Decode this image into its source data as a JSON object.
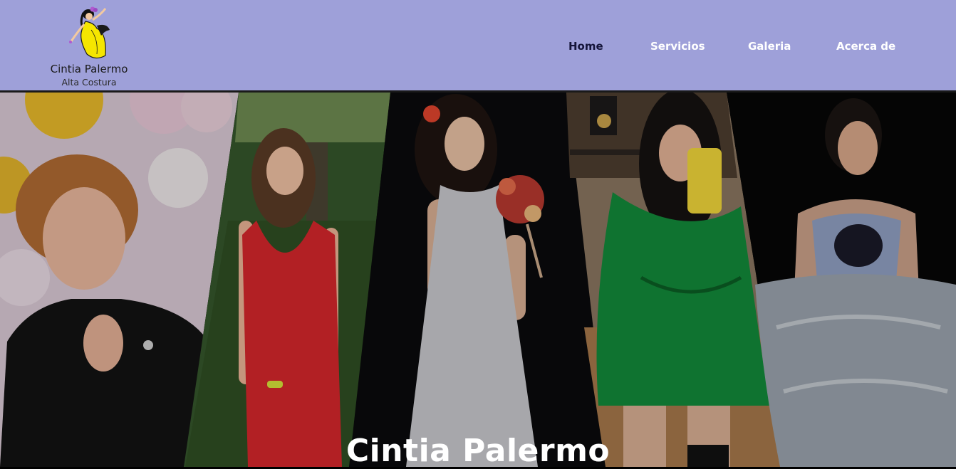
{
  "brand": {
    "name": "Cintia Palermo",
    "subtitle": "Alta Costura",
    "logo_icon": "dancing-woman-yellow-dress-logo"
  },
  "nav": {
    "items": [
      {
        "label": "Home",
        "active": true
      },
      {
        "label": "Servicios",
        "active": false
      },
      {
        "label": "Galeria",
        "active": false
      },
      {
        "label": "Acerca de",
        "active": false
      }
    ]
  },
  "hero": {
    "title": "Cintia Palermo",
    "panels": [
      "photo-woman-black-lace-dress",
      "photo-woman-red-dress",
      "photo-woman-white-dress-bouquet",
      "photo-woman-green-satin-dress",
      "photo-woman-ball-gown"
    ]
  },
  "colors": {
    "header_bg": "#9ea0d9",
    "nav_active": "#15153a",
    "nav_inactive": "#ffffff",
    "logo_dress": "#f5e600"
  }
}
